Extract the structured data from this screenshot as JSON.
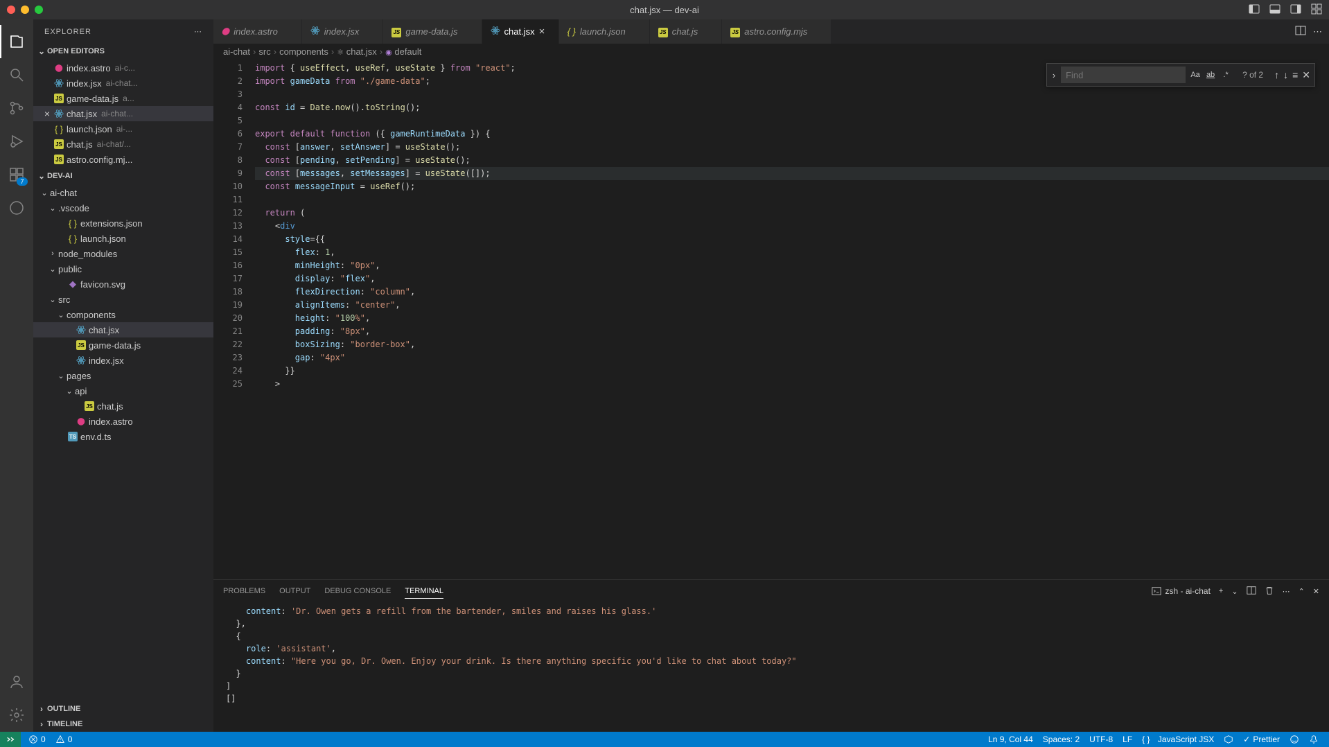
{
  "title": "chat.jsx — dev-ai",
  "sidebar": {
    "title": "EXPLORER",
    "sections": {
      "openEditors": "OPEN EDITORS",
      "project": "DEV-AI",
      "outline": "OUTLINE",
      "timeline": "TIMELINE"
    },
    "openEditorItems": [
      {
        "name": "index.astro",
        "hint": "ai-c..."
      },
      {
        "name": "index.jsx",
        "hint": "ai-chat..."
      },
      {
        "name": "game-data.js",
        "hint": "a..."
      },
      {
        "name": "chat.jsx",
        "hint": "ai-chat...",
        "active": true
      },
      {
        "name": "launch.json",
        "hint": "ai-..."
      },
      {
        "name": "chat.js",
        "hint": "ai-chat/..."
      },
      {
        "name": "astro.config.mj...",
        "hint": ""
      }
    ],
    "tree": [
      {
        "name": "ai-chat",
        "depth": 0,
        "kind": "folder",
        "open": true
      },
      {
        "name": ".vscode",
        "depth": 1,
        "kind": "folder",
        "open": true
      },
      {
        "name": "extensions.json",
        "depth": 2,
        "kind": "json"
      },
      {
        "name": "launch.json",
        "depth": 2,
        "kind": "json"
      },
      {
        "name": "node_modules",
        "depth": 1,
        "kind": "folder",
        "open": false
      },
      {
        "name": "public",
        "depth": 1,
        "kind": "folder",
        "open": true
      },
      {
        "name": "favicon.svg",
        "depth": 2,
        "kind": "svg"
      },
      {
        "name": "src",
        "depth": 1,
        "kind": "folder",
        "open": true
      },
      {
        "name": "components",
        "depth": 2,
        "kind": "folder",
        "open": true
      },
      {
        "name": "chat.jsx",
        "depth": 3,
        "kind": "jsx",
        "selected": true
      },
      {
        "name": "game-data.js",
        "depth": 3,
        "kind": "js"
      },
      {
        "name": "index.jsx",
        "depth": 3,
        "kind": "jsx"
      },
      {
        "name": "pages",
        "depth": 2,
        "kind": "folder",
        "open": true
      },
      {
        "name": "api",
        "depth": 3,
        "kind": "folder",
        "open": true
      },
      {
        "name": "chat.js",
        "depth": 4,
        "kind": "js"
      },
      {
        "name": "index.astro",
        "depth": 3,
        "kind": "astro"
      },
      {
        "name": "env.d.ts",
        "depth": 2,
        "kind": "ts"
      }
    ]
  },
  "tabs": [
    {
      "label": "index.astro",
      "kind": "astro"
    },
    {
      "label": "index.jsx",
      "kind": "jsx"
    },
    {
      "label": "game-data.js",
      "kind": "js"
    },
    {
      "label": "chat.jsx",
      "kind": "jsx",
      "active": true
    },
    {
      "label": "launch.json",
      "kind": "json"
    },
    {
      "label": "chat.js",
      "kind": "js"
    },
    {
      "label": "astro.config.mjs",
      "kind": "js"
    }
  ],
  "breadcrumbs": [
    "ai-chat",
    "src",
    "components",
    "chat.jsx",
    "default"
  ],
  "find": {
    "placeholder": "Find",
    "count": "? of 2"
  },
  "editor": {
    "lines": [
      "import { useEffect, useRef, useState } from \"react\";",
      "import gameData from \"./game-data\";",
      "",
      "const id = Date.now().toString();",
      "",
      "export default function ({ gameRuntimeData }) {",
      "  const [answer, setAnswer] = useState();",
      "  const [pending, setPending] = useState();",
      "  const [messages, setMessages] = useState([]);",
      "  const messageInput = useRef();",
      "",
      "  return (",
      "    <div",
      "      style={{",
      "        flex: 1,",
      "        minHeight: \"0px\",",
      "        display: \"flex\",",
      "        flexDirection: \"column\",",
      "        alignItems: \"center\",",
      "        height: \"100%\",",
      "        padding: \"8px\",",
      "        boxSizing: \"border-box\",",
      "        gap: \"4px\"",
      "      }}",
      "    >"
    ],
    "startLine": 1
  },
  "panel": {
    "tabs": [
      "PROBLEMS",
      "OUTPUT",
      "DEBUG CONSOLE",
      "TERMINAL"
    ],
    "activeTab": "TERMINAL",
    "terminalLabel": "zsh - ai-chat",
    "terminalLines": [
      "    content: 'Dr. Owen gets a refill from the bartender, smiles and raises his glass.'",
      "  },",
      "  {",
      "    role: 'assistant',",
      "    content: \"Here you go, Dr. Owen. Enjoy your drink. Is there anything specific you'd like to chat about today?\"",
      "  }",
      "]",
      "[]"
    ]
  },
  "statusbar": {
    "errors": "0",
    "warnings": "0",
    "cursor": "Ln 9, Col 44",
    "spaces": "Spaces: 2",
    "encoding": "UTF-8",
    "eol": "LF",
    "lang": "JavaScript JSX",
    "prettier": "Prettier"
  },
  "activitybar": {
    "badge": "7"
  }
}
